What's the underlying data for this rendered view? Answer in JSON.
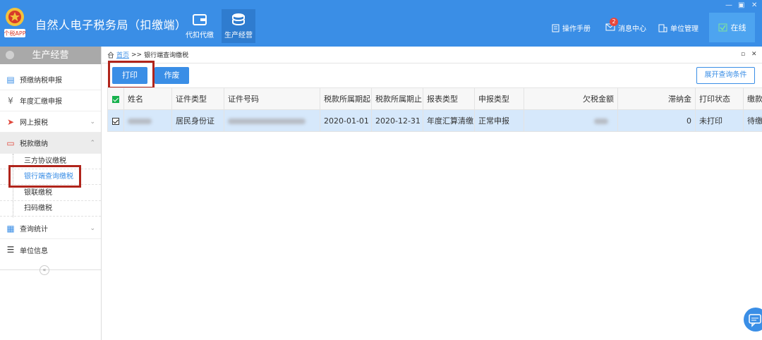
{
  "header": {
    "logo_text": "个税APP",
    "app_title": "自然人电子税务局（扣缴端）",
    "tabs": [
      {
        "label": "代扣代缴",
        "icon": "wallet-icon"
      },
      {
        "label": "生产经营",
        "icon": "coins-stack-icon",
        "active": true
      }
    ],
    "right": {
      "manual": "操作手册",
      "messages": "消息中心",
      "message_count": "2",
      "unit_mgmt": "单位管理",
      "status": "在线"
    }
  },
  "sidebar": {
    "title": "生产经营",
    "items": [
      {
        "label": "预缴纳税申报",
        "icon": "clipboard-icon"
      },
      {
        "label": "年度汇缴申报",
        "icon": "yen-circle-icon"
      },
      {
        "label": "网上报税",
        "icon": "paper-plane-icon",
        "chevron": "down"
      },
      {
        "label": "税款缴纳",
        "icon": "payment-terminal-icon",
        "chevron": "up"
      },
      {
        "label": "查询统计",
        "icon": "report-icon",
        "chevron": "down"
      },
      {
        "label": "单位信息",
        "icon": "list-icon"
      }
    ],
    "sub_items": [
      "三方协议缴税",
      "银行端查询缴税",
      "银联缴税",
      "扫码缴税"
    ],
    "collapse_symbol": "«"
  },
  "main": {
    "breadcrumb": {
      "home": "首页",
      "separator": ">>",
      "current": "银行端查询缴税"
    },
    "toolbar": {
      "print": "打印",
      "void": "作废",
      "expand_query": "展开查询条件"
    },
    "table": {
      "columns": [
        "姓名",
        "证件类型",
        "证件号码",
        "税款所属期起",
        "税款所属期止",
        "报表类型",
        "申报类型",
        "欠税金额",
        "滞纳金",
        "打印状态",
        "缴款"
      ],
      "rows": [
        {
          "id_type": "居民身份证",
          "period_start": "2020-01-01",
          "period_end": "2020-12-31",
          "report_type": "年度汇算清缴",
          "declare_type": "正常申报",
          "late_fee": "0",
          "print_status": "未打印",
          "pay_status": "待缴"
        }
      ]
    }
  },
  "colors": {
    "primary": "#3a8ee6",
    "highlight_box": "#b0241b",
    "selected_row": "#d6e8fb",
    "checkbox_green": "#17b14d"
  }
}
